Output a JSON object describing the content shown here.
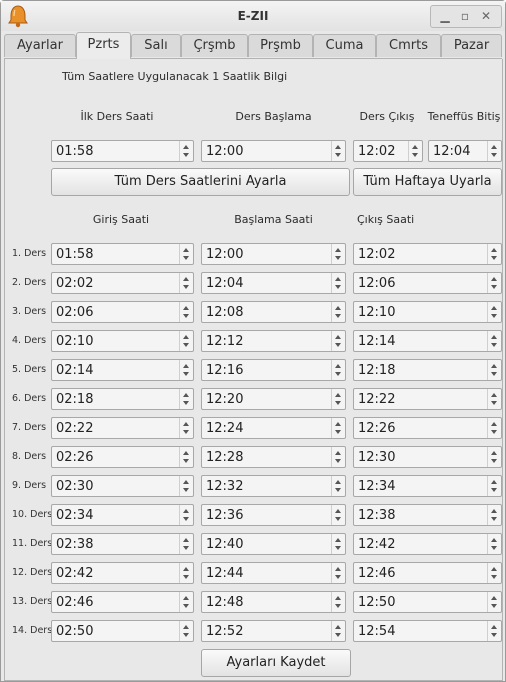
{
  "window": {
    "title": "E-ZII"
  },
  "tabs": [
    "Ayarlar",
    "Pzrts",
    "Salı",
    "Çrşmb",
    "Prşmb",
    "Cuma",
    "Cmrts",
    "Pazar"
  ],
  "active_tab": "Pzrts",
  "info_text": "Tüm Saatlere Uygulanacak 1 Saatlik Bilgi",
  "top_headers": {
    "ilk_ders": "İlk Ders Saati",
    "ders_baslama": "Ders Başlama",
    "ders_cikis": "Ders Çıkış",
    "teneffus_bitis": "Teneffüs Bitiş"
  },
  "top_values": {
    "ilk_ders": "01:58",
    "ders_baslama": "12:00",
    "ders_cikis": "12:02",
    "teneffus_bitis": "12:04"
  },
  "buttons": {
    "apply_all": "Tüm Ders Saatlerini Ayarla",
    "apply_week": "Tüm Haftaya Uyarla",
    "save": "Ayarları Kaydet"
  },
  "columns": {
    "giris": "Giriş Saati",
    "baslama": "Başlama Saati",
    "cikis": "Çıkış Saati"
  },
  "rows": [
    {
      "label": "1. Ders",
      "giris": "01:58",
      "baslama": "12:00",
      "cikis": "12:02"
    },
    {
      "label": "2. Ders",
      "giris": "02:02",
      "baslama": "12:04",
      "cikis": "12:06"
    },
    {
      "label": "3. Ders",
      "giris": "02:06",
      "baslama": "12:08",
      "cikis": "12:10"
    },
    {
      "label": "4. Ders",
      "giris": "02:10",
      "baslama": "12:12",
      "cikis": "12:14"
    },
    {
      "label": "5. Ders",
      "giris": "02:14",
      "baslama": "12:16",
      "cikis": "12:18"
    },
    {
      "label": "6. Ders",
      "giris": "02:18",
      "baslama": "12:20",
      "cikis": "12:22"
    },
    {
      "label": "7. Ders",
      "giris": "02:22",
      "baslama": "12:24",
      "cikis": "12:26"
    },
    {
      "label": "8. Ders",
      "giris": "02:26",
      "baslama": "12:28",
      "cikis": "12:30"
    },
    {
      "label": "9. Ders",
      "giris": "02:30",
      "baslama": "12:32",
      "cikis": "12:34"
    },
    {
      "label": "10. Ders",
      "giris": "02:34",
      "baslama": "12:36",
      "cikis": "12:38"
    },
    {
      "label": "11. Ders",
      "giris": "02:38",
      "baslama": "12:40",
      "cikis": "12:42"
    },
    {
      "label": "12. Ders",
      "giris": "02:42",
      "baslama": "12:44",
      "cikis": "12:46"
    },
    {
      "label": "13. Ders",
      "giris": "02:46",
      "baslama": "12:48",
      "cikis": "12:50"
    },
    {
      "label": "14. Ders",
      "giris": "02:50",
      "baslama": "12:52",
      "cikis": "12:54"
    }
  ]
}
